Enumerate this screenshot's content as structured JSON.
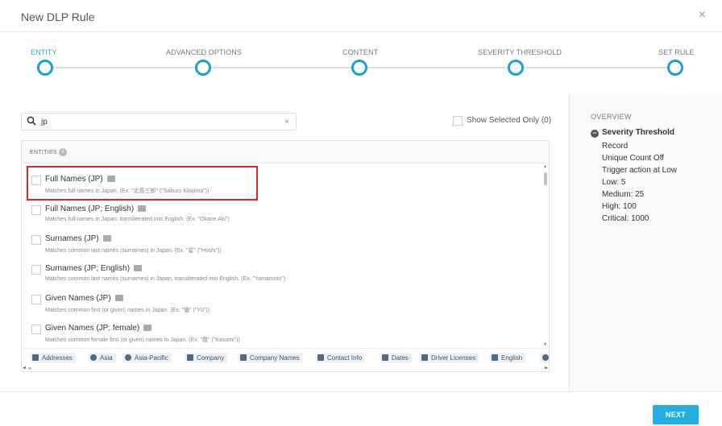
{
  "header": {
    "title": "New DLP Rule",
    "close_glyph": "×"
  },
  "steps": [
    {
      "label": "ENTITY",
      "active": true
    },
    {
      "label": "ADVANCED OPTIONS",
      "active": false
    },
    {
      "label": "CONTENT",
      "active": false
    },
    {
      "label": "SEVERITY THRESHOLD",
      "active": false
    },
    {
      "label": "SET RULE",
      "active": false
    }
  ],
  "search": {
    "value": "jp",
    "clear_glyph": "×",
    "icon": "search-icon"
  },
  "show_selected": {
    "label": "Show Selected Only (0)",
    "checked": false
  },
  "entities_panel": {
    "header": "ENTITIES",
    "items": [
      {
        "name": "Full Names (JP)",
        "desc": "Matches full names in Japan. (Ex. \"北島三郎\" (\"Saburo Kitajima\"))",
        "checked": false
      },
      {
        "name": "Full Names (JP; English)",
        "desc": "Matches full names in Japan, transliterated into English. (Ex. \"Okane Aki\")",
        "checked": false
      },
      {
        "name": "Surnames (JP)",
        "desc": "Matches common last names (surnames) in Japan. (Ex. \"星\" (\"Hoshi\"))",
        "checked": false
      },
      {
        "name": "Surnames (JP; English)",
        "desc": "Matches common last names (surnames) in Japan, transliterated into English. (Ex. \"Yamamoto\")",
        "checked": false
      },
      {
        "name": "Given Names (JP)",
        "desc": "Matches common first (or given) names in Japan. (Ex. \"優\" (\"Yū\"))",
        "checked": false
      },
      {
        "name": "Given Names (JP; female)",
        "desc": "Matches common female first (or given) names in Japan. (Ex. \"霞\" (\"Kasumi\"))",
        "checked": false
      }
    ],
    "tags": [
      {
        "label": "Addresses",
        "icon": "tag-icon"
      },
      {
        "label": "Asia",
        "icon": "globe-icon"
      },
      {
        "label": "Asia-Pacific",
        "icon": "globe-icon"
      },
      {
        "label": "Company",
        "icon": "tag-icon"
      },
      {
        "label": "Company Names",
        "icon": "tag-icon"
      },
      {
        "label": "Contact Info",
        "icon": "tag-icon"
      },
      {
        "label": "Dates",
        "icon": "tag-icon"
      },
      {
        "label": "Driver Licenses",
        "icon": "tag-icon"
      },
      {
        "label": "English",
        "icon": "chat-icon"
      }
    ]
  },
  "overview": {
    "title": "OVERVIEW",
    "section": "Severity Threshold",
    "lines": [
      "Record",
      "Unique Count Off",
      "Trigger action at Low",
      "Low: 5",
      "Medium: 25",
      "High: 100",
      "Critical: 1000"
    ]
  },
  "footer": {
    "next_label": "NEXT"
  },
  "colors": {
    "accent": "#22b0e0",
    "highlight": "#d9262b"
  }
}
